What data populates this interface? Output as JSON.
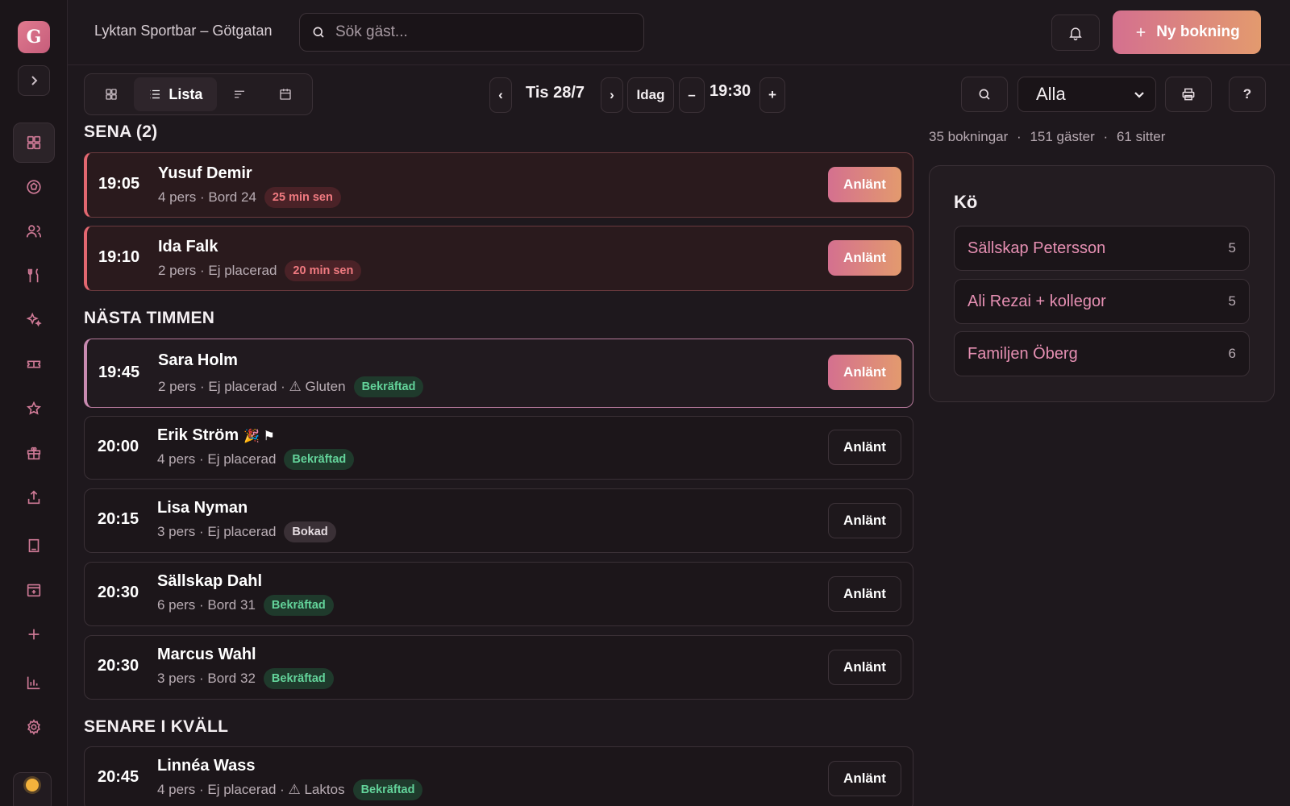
{
  "app": {
    "logo_letter": "G",
    "venue": "Lyktan Sportbar – Götgatan"
  },
  "search": {
    "placeholder": "Sök gäst..."
  },
  "header": {
    "new_booking": "Ny bokning"
  },
  "sidebar": {
    "items": [
      {
        "icon": "grid-icon",
        "active": true
      },
      {
        "icon": "football-icon"
      },
      {
        "icon": "users-icon"
      },
      {
        "icon": "cutlery-icon"
      },
      {
        "icon": "sparkles-icon"
      },
      {
        "icon": "ticket-icon"
      },
      {
        "icon": "star-icon"
      },
      {
        "icon": "gift-icon"
      },
      {
        "icon": "upload-icon"
      },
      {
        "icon": "book-icon"
      },
      {
        "icon": "calendar-plus-icon"
      },
      {
        "icon": "plus-icon"
      },
      {
        "icon": "bar-chart-icon"
      },
      {
        "icon": "settings-icon"
      }
    ]
  },
  "toolbar": {
    "view_list_label": "Lista",
    "date": "Tis 28/7",
    "today": "Idag",
    "minus": "–",
    "time": "19:30",
    "plus": "+",
    "prev": "‹",
    "next": "›",
    "filter_selected": "Alla",
    "help": "?"
  },
  "summary": {
    "bookings": "35 bokningar",
    "guests": "151 gäster",
    "seated": "61 sitter",
    "sep": "·"
  },
  "sections": {
    "late": "SENA (2)",
    "next_hour": "NÄSTA TIMMEN",
    "later": "SENARE I KVÄLL"
  },
  "arrive_label": "Anlänt",
  "bookings": {
    "late": [
      {
        "time": "19:05",
        "name": "Yusuf Demir",
        "meta": "4 pers · Bord 24",
        "badge": "25 min sen"
      },
      {
        "time": "19:10",
        "name": "Ida Falk",
        "meta": "2 pers · Ej placerad",
        "badge": "20 min sen"
      }
    ],
    "next": [
      {
        "time": "19:45",
        "name": "Sara Holm",
        "meta": "2 pers · Ej placerad · ⚠ Gluten",
        "badge": "Bekräftad"
      },
      {
        "time": "20:00",
        "name": "Erik Ström",
        "emoji": "🎉 ⚑",
        "meta": "4 pers · Ej placerad",
        "badge": "Bekräftad"
      },
      {
        "time": "20:15",
        "name": "Lisa Nyman",
        "meta": "3 pers · Ej placerad",
        "badge": "Bokad"
      },
      {
        "time": "20:30",
        "name": "Sällskap Dahl",
        "meta": "6 pers · Bord 31",
        "badge": "Bekräftad"
      },
      {
        "time": "20:30",
        "name": "Marcus Wahl",
        "meta": "3 pers · Bord 32",
        "badge": "Bekräftad"
      }
    ],
    "later": [
      {
        "time": "20:45",
        "name": "Linnéa Wass",
        "meta": "4 pers · Ej placerad · ⚠ Laktos",
        "badge": "Bekräftad"
      }
    ]
  },
  "queue": {
    "title": "Kö",
    "items": [
      {
        "name": "Sällskap Petersson",
        "count": "5"
      },
      {
        "name": "Ali Rezai + kollegor",
        "count": "5"
      },
      {
        "name": "Familjen Öberg",
        "count": "6"
      }
    ]
  }
}
